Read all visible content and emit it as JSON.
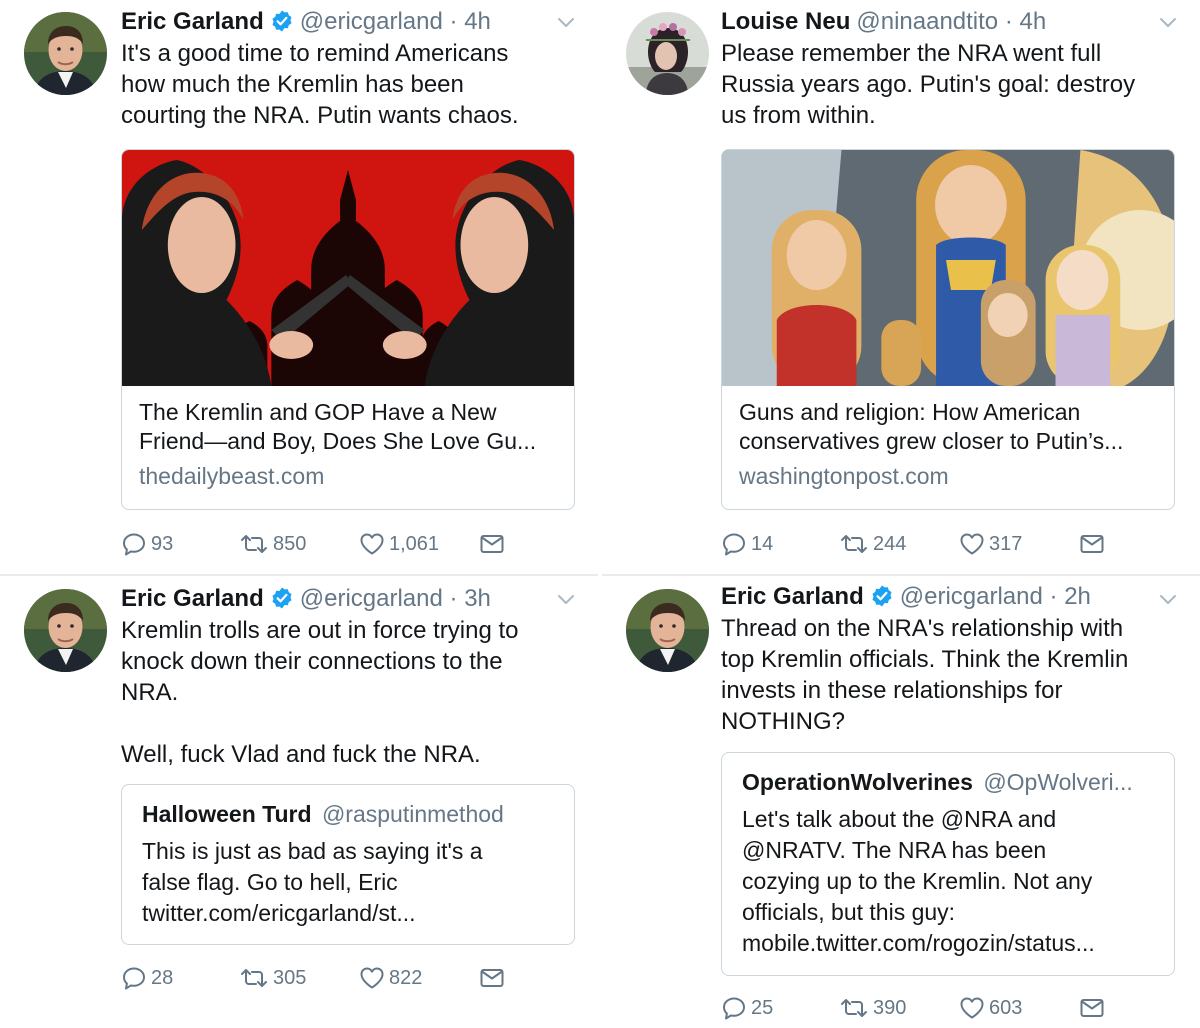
{
  "colors": {
    "verified": "#1da1f2",
    "secondary": "#657786",
    "border": "#ccd6dd"
  },
  "tweets": [
    {
      "name": "Eric Garland",
      "verified": true,
      "handle": "@ericgarland",
      "dot": "·",
      "time": "4h",
      "text": "It's a good time to remind Americans\nhow much the Kremlin has been\ncourting the NRA. Putin wants chaos.",
      "card": {
        "title": "The Kremlin and GOP Have a New\nFriend—and Boy, Does She Love Gu...",
        "domain": "thedailybeast.com"
      },
      "replies": "93",
      "retweets": "850",
      "likes": "1,061"
    },
    {
      "name": "Louise Neu",
      "verified": false,
      "handle": "@ninaandtito",
      "dot": "·",
      "time": "4h",
      "text": "Please remember the NRA went full\nRussia years ago. Putin's goal: destroy\nus from within.",
      "card": {
        "title": "Guns and religion: How American\nconservatives grew closer to Putin’s...",
        "domain": "washingtonpost.com"
      },
      "replies": "14",
      "retweets": "244",
      "likes": "317"
    },
    {
      "name": "Eric Garland",
      "verified": true,
      "handle": "@ericgarland",
      "dot": "·",
      "time": "3h",
      "text": "Kremlin trolls are out in force trying to\nknock down their connections to the\nNRA.\n\nWell, fuck Vlad and fuck the NRA.",
      "quote": {
        "name": "Halloween Turd",
        "handle": "@rasputinmethod",
        "text": "This is just as bad as saying it's a\nfalse flag. Go to hell, Eric\ntwitter.com/ericgarland/st..."
      },
      "replies": "28",
      "retweets": "305",
      "likes": "822"
    },
    {
      "name": "Eric Garland",
      "verified": true,
      "handle": "@ericgarland",
      "dot": "·",
      "time": "2h",
      "text": "Thread on the NRA's relationship with\ntop Kremlin officials. Think the Kremlin\ninvests in these relationships for\nNOTHING?",
      "quote": {
        "name": "OperationWolverines",
        "handle": "@OpWolveri...",
        "text": "Let's talk about the @NRA and\n@NRATV. The NRA has been\ncozying up to the Kremlin. Not any\nofficials, but this guy:\nmobile.twitter.com/rogozin/status..."
      },
      "replies": "25",
      "retweets": "390",
      "likes": "603"
    }
  ]
}
